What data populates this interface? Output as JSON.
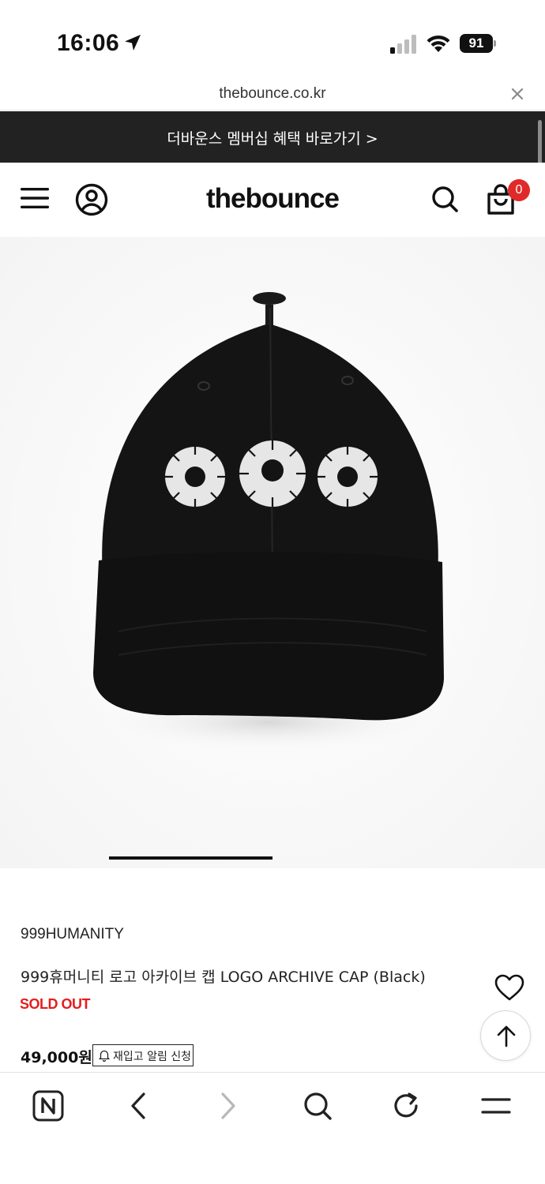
{
  "status_bar": {
    "time": "16:06",
    "battery": "91",
    "icons": [
      "location-arrow-icon",
      "cellular-signal-icon",
      "wifi-icon",
      "battery-icon"
    ]
  },
  "url_bar": {
    "url": "thebounce.co.kr",
    "close_icon": "close-icon"
  },
  "promo_banner": {
    "text": "더바운스 멤버십 혜택 바로가기 >",
    "background": "#222222"
  },
  "header": {
    "logo": "thebounce",
    "cart_count": "0",
    "badge_color": "#e02a2a",
    "icons": [
      "menu-icon",
      "user-icon",
      "search-icon",
      "shopping-bag-icon"
    ]
  },
  "product_image": {
    "subject": "black baseball cap with three white embroidered circle logos",
    "carousel": {
      "active_index": 1,
      "total": 3
    }
  },
  "product": {
    "brand": "999HUMANITY",
    "title": "999휴머니티 로고 아카이브 캡 LOGO ARCHIVE CAP (Black)",
    "status": "SOLD OUT",
    "status_color": "#e41e1e",
    "price": "49,000원",
    "restock_button": "재입고 알림 신청"
  },
  "toolbar": {
    "icons": [
      "naver-home-icon",
      "back-icon",
      "forward-icon",
      "search-icon",
      "refresh-icon",
      "menu-icon"
    ]
  }
}
